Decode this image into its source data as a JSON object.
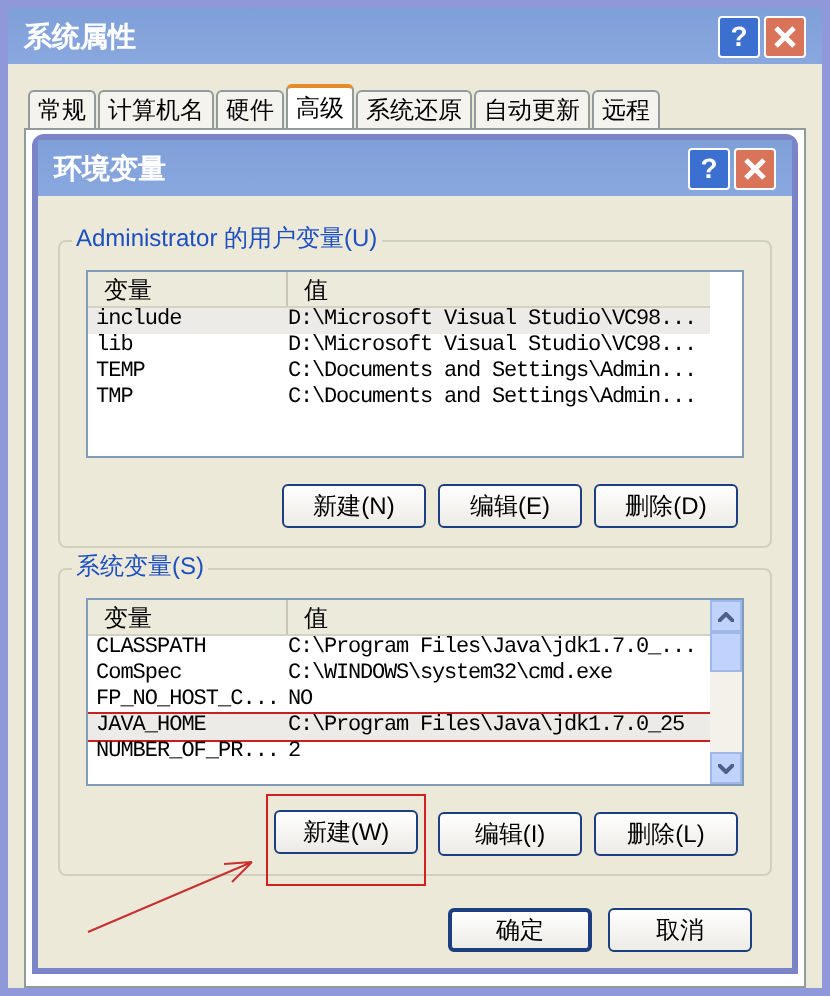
{
  "window": {
    "title": "系统属性",
    "help": "?"
  },
  "tabs": [
    {
      "label": "常规",
      "selected": false
    },
    {
      "label": "计算机名",
      "selected": false
    },
    {
      "label": "硬件",
      "selected": false
    },
    {
      "label": "高级",
      "selected": true
    },
    {
      "label": "系统还原",
      "selected": false
    },
    {
      "label": "自动更新",
      "selected": false
    },
    {
      "label": "远程",
      "selected": false
    }
  ],
  "dialog": {
    "title": "环境变量",
    "help": "?",
    "groups": [
      {
        "title": "Administrator 的用户变量(U)",
        "columns": [
          "变量",
          "值"
        ],
        "scrollbar": false,
        "rows": [
          {
            "name": "include",
            "value": "D:\\Microsoft Visual Studio\\VC98...",
            "selected": true,
            "annotated": false
          },
          {
            "name": "lib",
            "value": "D:\\Microsoft Visual Studio\\VC98...",
            "selected": false,
            "annotated": false
          },
          {
            "name": "TEMP",
            "value": "C:\\Documents and Settings\\Admin...",
            "selected": false,
            "annotated": false
          },
          {
            "name": "TMP",
            "value": "C:\\Documents and Settings\\Admin...",
            "selected": false,
            "annotated": false
          }
        ],
        "buttons": [
          {
            "label": "新建(N)",
            "annotated": false
          },
          {
            "label": "编辑(E)",
            "annotated": false
          },
          {
            "label": "删除(D)",
            "annotated": false
          }
        ]
      },
      {
        "title": "系统变量(S)",
        "columns": [
          "变量",
          "值"
        ],
        "scrollbar": true,
        "rows": [
          {
            "name": "CLASSPATH",
            "value": "C:\\Program Files\\Java\\jdk1.7.0_...",
            "selected": false,
            "annotated": false
          },
          {
            "name": "ComSpec",
            "value": "C:\\WINDOWS\\system32\\cmd.exe",
            "selected": false,
            "annotated": false
          },
          {
            "name": "FP_NO_HOST_C...",
            "value": "NO",
            "selected": false,
            "annotated": false
          },
          {
            "name": "JAVA_HOME",
            "value": "C:\\Program Files\\Java\\jdk1.7.0_25",
            "selected": true,
            "annotated": true
          },
          {
            "name": "NUMBER_OF_PR...",
            "value": "2",
            "selected": false,
            "annotated": false
          }
        ],
        "buttons": [
          {
            "label": "新建(W)",
            "annotated": true
          },
          {
            "label": "编辑(I)",
            "annotated": false
          },
          {
            "label": "删除(L)",
            "annotated": false
          }
        ]
      }
    ],
    "footer_buttons": [
      {
        "label": "确定",
        "default": true
      },
      {
        "label": "取消",
        "default": false
      }
    ]
  }
}
